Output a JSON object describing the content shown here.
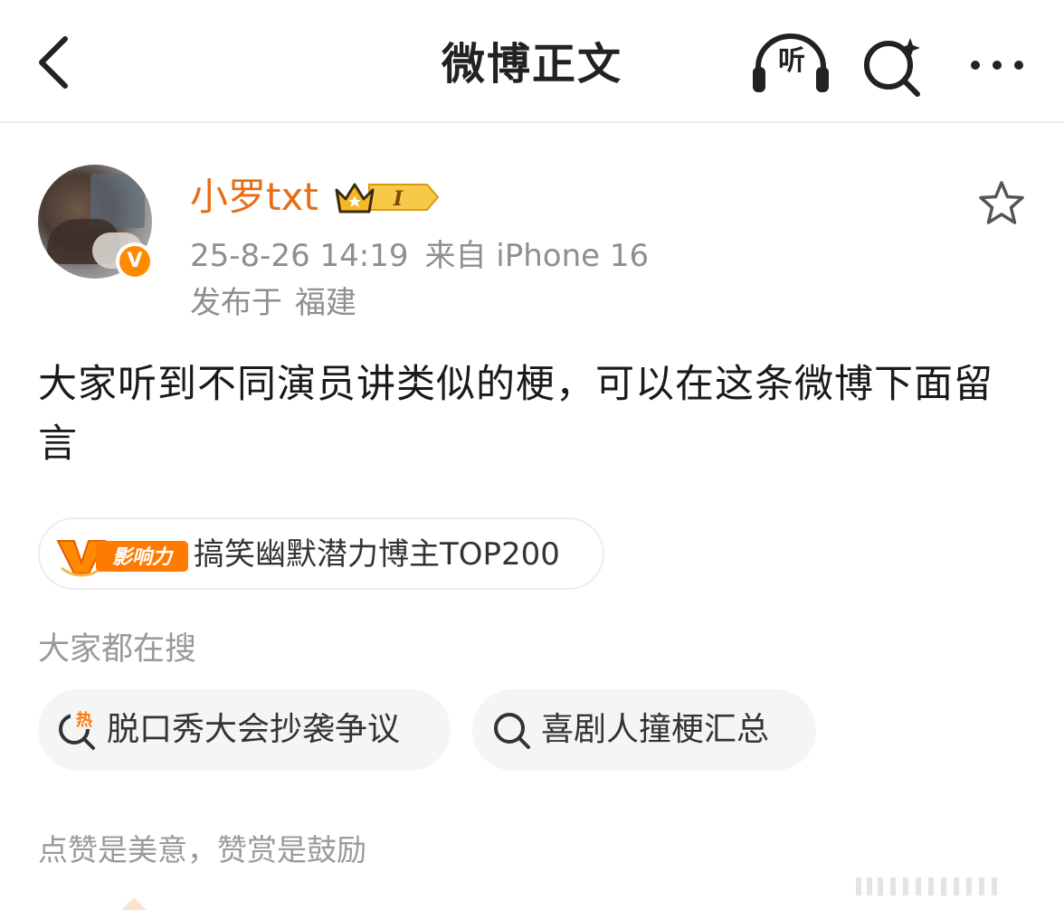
{
  "header": {
    "title": "微博正文",
    "listen_label": "听"
  },
  "post": {
    "username": "小罗txt",
    "member_level": "I",
    "time": "25-8-26 14:19",
    "source": "来自 iPhone 16",
    "location_prefix": "发布于",
    "location": "福建",
    "body": "大家听到不同演员讲类似的梗，可以在这条微博下面留言",
    "verified_mark": "V"
  },
  "influence": {
    "badge": "影响力",
    "text": "搞笑幽默潜力博主TOP200"
  },
  "search": {
    "title": "大家都在搜",
    "chips": [
      {
        "label": "脱口秀大会抄袭争议",
        "icon": "hot-search-icon",
        "badge": "热"
      },
      {
        "label": "喜剧人撞梗汇总",
        "icon": "search-icon"
      }
    ]
  },
  "reward": {
    "note": "点赞是美意，赞赏是鼓励"
  },
  "colors": {
    "username": "#e86d15",
    "verified": "#ff8a00",
    "secondary_text": "#8f8f8f",
    "chip_bg": "#f5f5f5",
    "hot_orange": "#ff7a00"
  }
}
